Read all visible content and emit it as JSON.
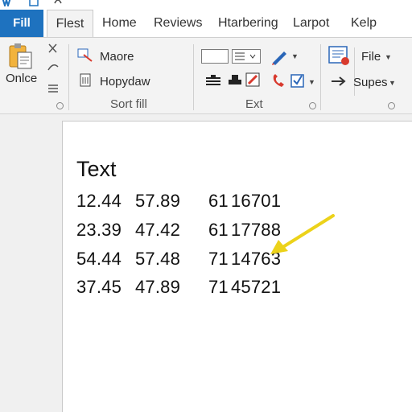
{
  "tabs": {
    "file": "Fill",
    "active": "Flest",
    "others": [
      "Home",
      "Reviews",
      "Htarbering",
      "Larpot",
      "Kelp"
    ]
  },
  "ribbon": {
    "clipboard": {
      "big_label": "Onlce"
    },
    "group1": {
      "item1": "Maore",
      "item2": "Hopydaw",
      "label": "Sort fill"
    },
    "group2": {
      "label": "Ext"
    },
    "group3": {
      "file": "File",
      "supes": "Supes"
    }
  },
  "document": {
    "title": "Text",
    "rows": [
      [
        "12.44",
        "57.89",
        "61",
        "16701"
      ],
      [
        "23.39",
        "47.42",
        "61",
        "17788"
      ],
      [
        "54.44",
        "57.48",
        "71",
        "14763"
      ],
      [
        "37.45",
        "47.89",
        "71",
        "45721"
      ]
    ]
  },
  "colors": {
    "file_tab": "#1e72bf",
    "arrow": "#ecd21a",
    "red": "#d83a2e",
    "blue": "#2a66b8"
  }
}
